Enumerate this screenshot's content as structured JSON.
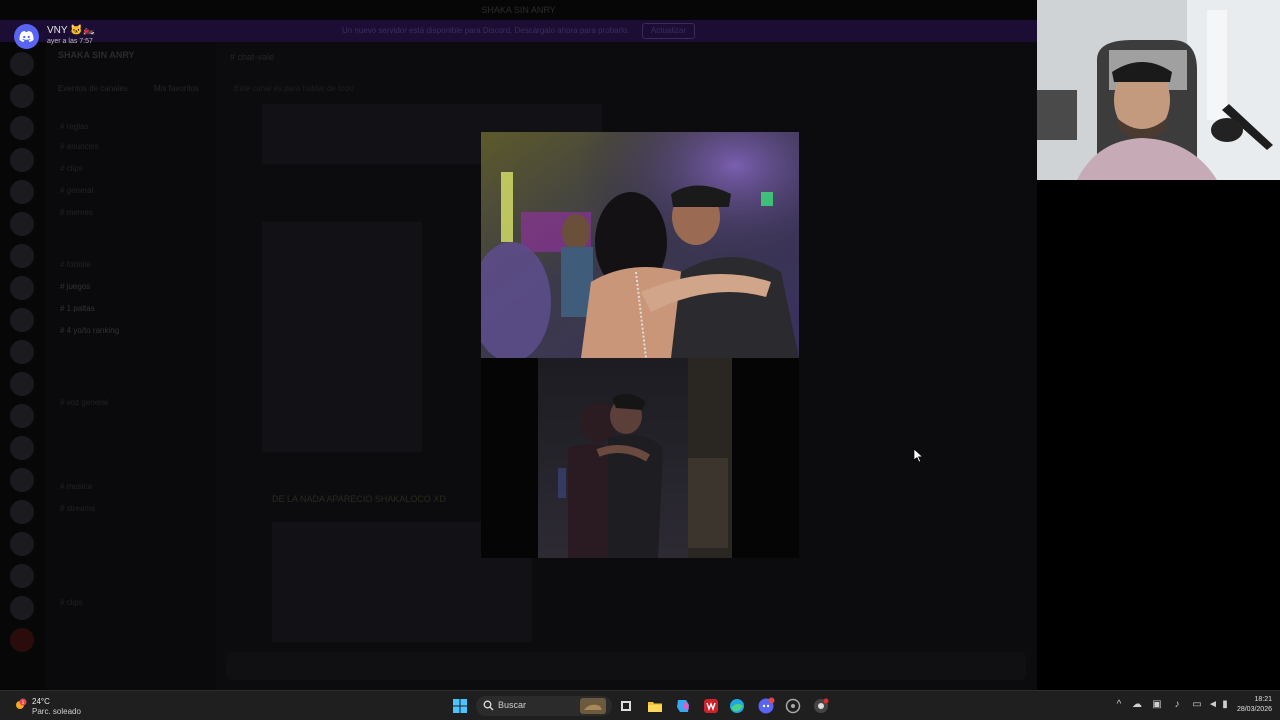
{
  "discord": {
    "titlebar": "SHAKA SIN ANRY",
    "banner_text": "Un nuevo servidor está disponible para Discord. Descárgalo ahora para probarlo.",
    "banner_button": "Actualizar",
    "server_name": "SHAKA SIN ANRY",
    "tabs": [
      "Eventos de canales",
      "Mis favoritos"
    ],
    "channels": [
      {
        "label": "# reglas"
      },
      {
        "label": "# anuncios"
      },
      {
        "label": "# clips"
      },
      {
        "label": "# general"
      },
      {
        "label": "# memes"
      },
      {
        "label": "# fortnite"
      },
      {
        "label": "# juegos"
      },
      {
        "label": "# 1 paltas"
      },
      {
        "label": "# 1 paltas"
      },
      {
        "label": "# 4 yo/to ranking"
      },
      {
        "label": "# voz general"
      },
      {
        "label": "# musica"
      },
      {
        "label": "# streams"
      },
      {
        "label": "# clips"
      }
    ],
    "chat_title": "# chat-vale",
    "chat_subtitle": "Este canal es para hablar de todo",
    "chat_message": "DE LA NADA APARECIO SHAKALOCO XD"
  },
  "notification": {
    "username": "VNY 🐱‍🏍",
    "time": "ayer a las 7:57"
  },
  "taskbar": {
    "weather_temp": "24°C",
    "weather_desc": "Parc. soleado",
    "weather_badge": "1",
    "search_label": "Buscar",
    "clock_time": "18:21",
    "clock_date": "28/03/2026"
  },
  "colors": {
    "discord_blurple": "#5865f2",
    "taskbar_bg": "#1f1f1f"
  }
}
